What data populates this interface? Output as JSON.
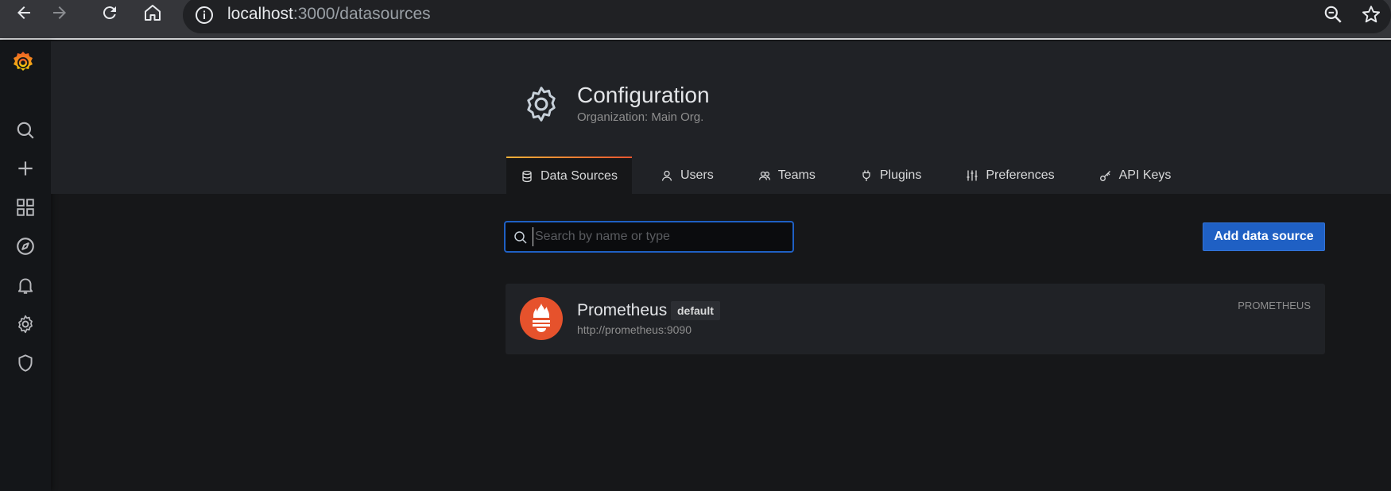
{
  "browser": {
    "url_host": "localhost",
    "url_rest": ":3000/datasources"
  },
  "sidebar": {
    "items": [
      {
        "name": "search"
      },
      {
        "name": "create"
      },
      {
        "name": "dashboards"
      },
      {
        "name": "explore"
      },
      {
        "name": "alerting"
      },
      {
        "name": "configuration"
      },
      {
        "name": "server-admin"
      }
    ]
  },
  "header": {
    "title": "Configuration",
    "subtitle": "Organization: Main Org."
  },
  "tabs": [
    {
      "label": "Data Sources",
      "icon": "database-icon",
      "active": true
    },
    {
      "label": "Users",
      "icon": "user-icon"
    },
    {
      "label": "Teams",
      "icon": "users-icon"
    },
    {
      "label": "Plugins",
      "icon": "plug-icon"
    },
    {
      "label": "Preferences",
      "icon": "sliders-icon"
    },
    {
      "label": "API Keys",
      "icon": "key-icon"
    }
  ],
  "search": {
    "placeholder": "Search by name or type",
    "value": ""
  },
  "actions": {
    "add_label": "Add data source"
  },
  "datasources": [
    {
      "name": "Prometheus",
      "badge": "default",
      "url": "http://prometheus:9090",
      "type": "PROMETHEUS"
    }
  ],
  "colors": {
    "accent": "#1f60c4",
    "prometheus": "#e6522c",
    "tab_gradient_start": "#f2b138",
    "tab_gradient_end": "#e8552f"
  }
}
